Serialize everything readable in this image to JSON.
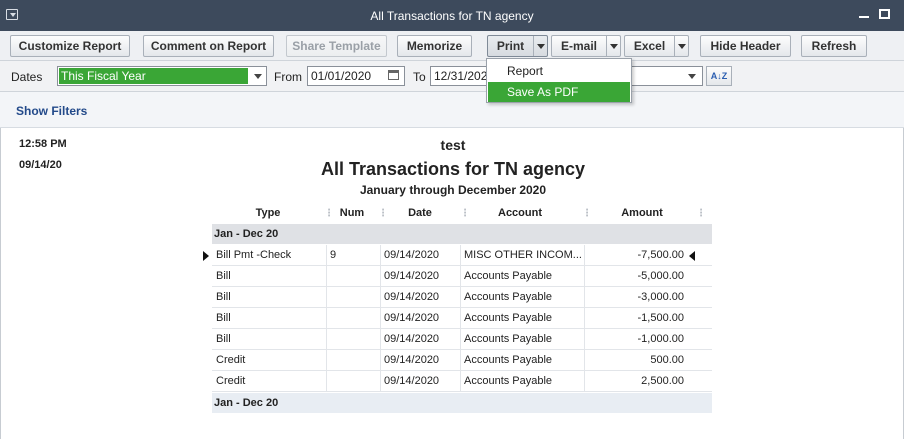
{
  "window": {
    "title": "All Transactions for TN agency"
  },
  "toolbar": {
    "customize": "Customize Report",
    "comment": "Comment on Report",
    "share": "Share Template",
    "memorize": "Memorize",
    "print": "Print",
    "email": "E-mail",
    "excel": "Excel",
    "hide_header": "Hide Header",
    "refresh": "Refresh"
  },
  "print_menu": {
    "items": [
      "Report",
      "Save As PDF"
    ],
    "highlighted": "Save As PDF"
  },
  "datebar": {
    "dates_label": "Dates",
    "dates_value": "This Fiscal Year",
    "from_label": "From",
    "from_value": "01/01/2020",
    "to_label": "To",
    "to_value": "12/31/202",
    "sort_icon": "sort-az-icon"
  },
  "filters": {
    "show_filters": "Show Filters"
  },
  "report": {
    "time": "12:58 PM",
    "date": "09/14/20",
    "company": "test",
    "title": "All Transactions for TN agency",
    "period": "January through December 2020",
    "columns": [
      "Type",
      "Num",
      "Date",
      "Account",
      "Amount"
    ],
    "group_label": "Jan - Dec 20",
    "rows": [
      {
        "type": "Bill Pmt -Check",
        "num": "9",
        "date": "09/14/2020",
        "account": "MISC OTHER INCOM...",
        "amount": "-7,500.00"
      },
      {
        "type": "Bill",
        "num": "",
        "date": "09/14/2020",
        "account": "Accounts Payable",
        "amount": "-5,000.00"
      },
      {
        "type": "Bill",
        "num": "",
        "date": "09/14/2020",
        "account": "Accounts Payable",
        "amount": "-3,000.00"
      },
      {
        "type": "Bill",
        "num": "",
        "date": "09/14/2020",
        "account": "Accounts Payable",
        "amount": "-1,500.00"
      },
      {
        "type": "Bill",
        "num": "",
        "date": "09/14/2020",
        "account": "Accounts Payable",
        "amount": "-1,000.00"
      },
      {
        "type": "Credit",
        "num": "",
        "date": "09/14/2020",
        "account": "Accounts Payable",
        "amount": "500.00"
      },
      {
        "type": "Credit",
        "num": "",
        "date": "09/14/2020",
        "account": "Accounts Payable",
        "amount": "2,500.00"
      }
    ],
    "total_label": "Jan - Dec 20"
  },
  "colors": {
    "title_bar": "#3d4a5c",
    "highlight_green": "#3aa636",
    "link_blue": "#234a8a"
  }
}
